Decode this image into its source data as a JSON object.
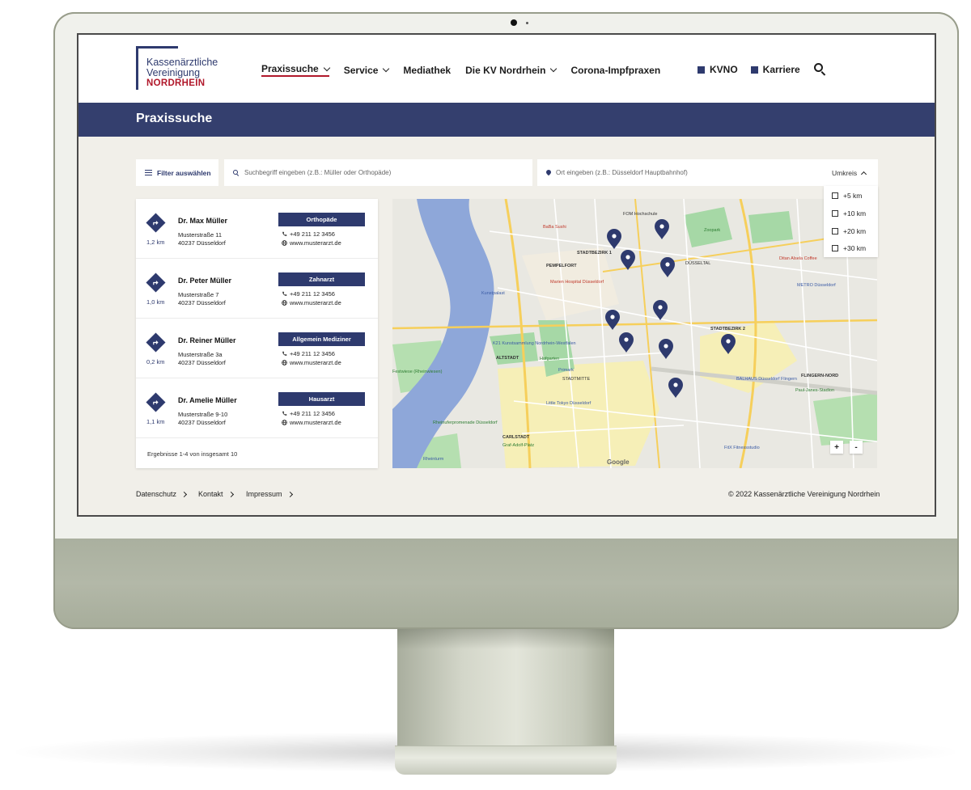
{
  "logo": {
    "line1": "Kassenärztliche",
    "line2": "Vereinigung",
    "line3": "NORDRHEIN"
  },
  "nav": {
    "items": [
      {
        "label": "Praxissuche",
        "has_dropdown": true,
        "active": true
      },
      {
        "label": "Service",
        "has_dropdown": true,
        "active": false
      },
      {
        "label": "Mediathek",
        "has_dropdown": false,
        "active": false
      },
      {
        "label": "Die KV Nordrhein",
        "has_dropdown": true,
        "active": false
      },
      {
        "label": "Corona-Impfpraxen",
        "has_dropdown": false,
        "active": false
      }
    ],
    "meta": [
      {
        "label": "KVNO"
      },
      {
        "label": "Karriere"
      }
    ],
    "search_icon": "search-icon"
  },
  "page": {
    "title": "Praxissuche"
  },
  "filters": {
    "filter_button": "Filter auswählen",
    "search_placeholder": "Suchbegriff eingeben (z.B.: Müller oder Orthopäde)",
    "location_placeholder": "Ort eingeben (z.B.: Düsseldorf Hauptbahnhof)",
    "radius_label": "Umkreis",
    "radius_options": [
      "+5 km",
      "+10 km",
      "+20 km",
      "+30 km"
    ]
  },
  "results": {
    "items": [
      {
        "name": "Dr. Max Müller",
        "street": "Musterstraße 11",
        "city": "40237 Düsseldorf",
        "distance": "1,2 km",
        "specialty": "Orthopäde",
        "phone": "+49 211 12 3456",
        "web": "www.musterarzt.de"
      },
      {
        "name": "Dr. Peter Müller",
        "street": "Musterstraße 7",
        "city": "40237 Düsseldorf",
        "distance": "1,0 km",
        "specialty": "Zahnarzt",
        "phone": "+49 211 12 3456",
        "web": "www.musterarzt.de"
      },
      {
        "name": "Dr. Reiner Müller",
        "street": "Musterstraße 3a",
        "city": "40237 Düsseldorf",
        "distance": "0,2 km",
        "specialty": "Allgemein Mediziner",
        "phone": "+49 211 12 3456",
        "web": "www.musterarzt.de"
      },
      {
        "name": "Dr. Amelie Müller",
        "street": "Musterstraße 9-10",
        "city": "40237 Düsseldorf",
        "distance": "1,1 km",
        "specialty": "Hausarzt",
        "phone": "+49 211 12 3456",
        "web": "www.musterarzt.de"
      }
    ],
    "summary": "Ergebnisse 1-4 von insgesamt 10"
  },
  "map": {
    "labels": [
      "STADTBEZIRK 1",
      "PEMPELFORT",
      "ALTSTADT",
      "CARLSTADT",
      "STADTBEZIRK 2",
      "FLINGERN-NORD",
      "DÜSSELTAL",
      "STADTMITTE",
      "Marien Hospital Düsseldorf",
      "Primark",
      "Hofgarten",
      "Zoopark",
      "Little Tokyo Düsseldorf",
      "Graf-Adolf-Platz",
      "BALHAUS Düsseldorf Flingern",
      "Paul-Janes-Stadion",
      "METRO Düsseldorf",
      "FitX Fitnessstudio",
      "Festwiese (Rheinwiesen)",
      "BaBa Sushi",
      "FOM Hochschule",
      "K21 Kunstsammlung Nordrhein-Westfalen",
      "Kunstpalast",
      "Ditan Alsela Coffee",
      "Rheinuferpromenade Düsseldorf",
      "Rheinturm"
    ],
    "zoom_in": "+",
    "zoom_out": "-",
    "attribution": "Google",
    "colors": {
      "water": "#8fa7d8",
      "park": "#9fd6a1",
      "road_major": "#f6cf5b",
      "road": "#ffffff",
      "built": "#f7efb4",
      "pin": "#2e3a6e"
    }
  },
  "footer": {
    "links": [
      "Datenschutz",
      "Kontakt",
      "Impressum"
    ],
    "copyright": "© 2022 Kassenärztliche Vereinigung Nordrhein"
  }
}
